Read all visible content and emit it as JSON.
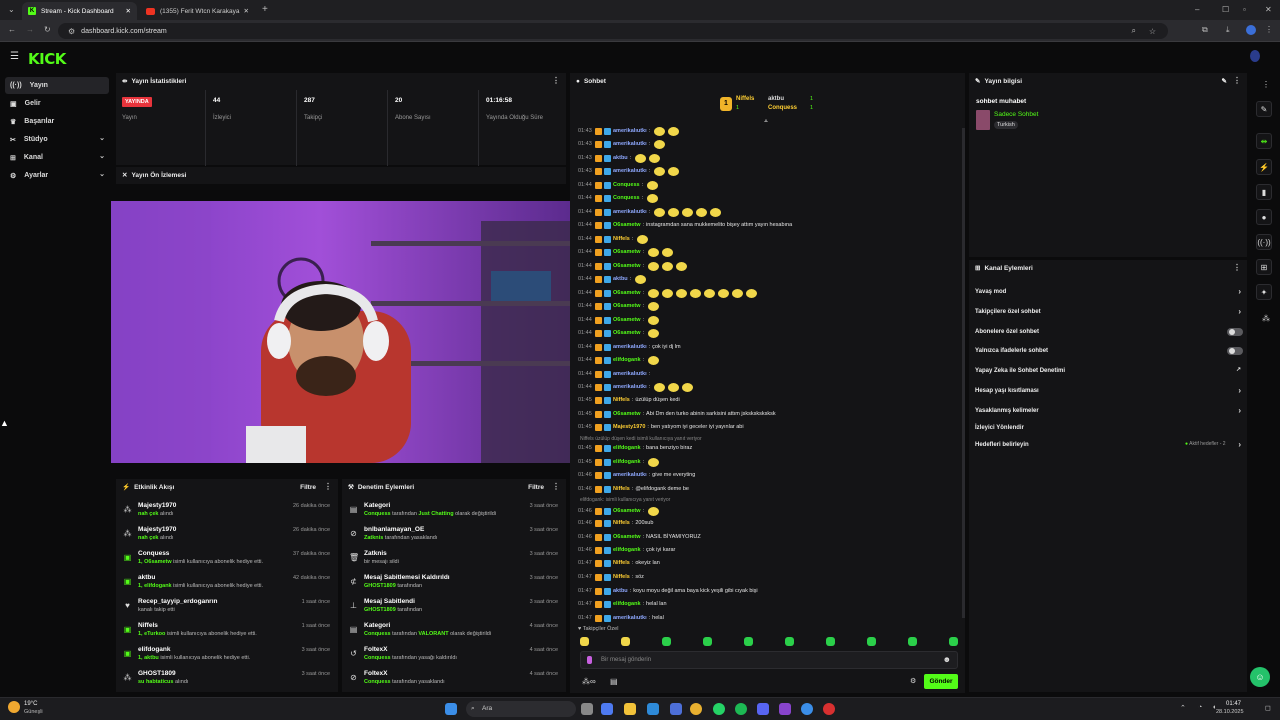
{
  "browser": {
    "tabs": [
      {
        "title": "Stream - Kick Dashboard",
        "active": true
      },
      {
        "title": "(1355) Ferit Wtcn Karakaya Saç",
        "active": false
      }
    ],
    "url": "dashboard.kick.com/stream"
  },
  "app": {
    "logo": "KICK",
    "accent": "#53fc18"
  },
  "sidebar": {
    "items": [
      {
        "label": "Yayın",
        "icon": "broadcast-icon",
        "active": true
      },
      {
        "label": "Gelir",
        "icon": "wallet-icon"
      },
      {
        "label": "Başarılar",
        "icon": "trophy-icon"
      },
      {
        "label": "Stüdyo",
        "icon": "studio-icon",
        "expandable": true
      },
      {
        "label": "Kanal",
        "icon": "channel-icon",
        "expandable": true
      },
      {
        "label": "Ayarlar",
        "icon": "gear-icon",
        "expandable": true
      }
    ]
  },
  "stats": {
    "title": "Yayın İstatistikleri",
    "live_badge": "YAYINDA",
    "live_label": "Yayın",
    "items": [
      {
        "value": "44",
        "label": "İzleyici"
      },
      {
        "value": "287",
        "label": "Takipçi"
      },
      {
        "value": "20",
        "label": "Abone Sayısı"
      },
      {
        "value": "01:16:58",
        "label": "Yayında Olduğu Süre"
      }
    ]
  },
  "preview": {
    "title": "Yayın Ön İzlemesi"
  },
  "activity": {
    "title": "Etkinlik Akışı",
    "filter": "Filtre",
    "items": [
      {
        "name": "Majesty1970",
        "highlight": "nah çek",
        "text": " alındı",
        "time": "26 dakika önce",
        "icon": "gift-icon"
      },
      {
        "name": "Majesty1970",
        "highlight": "nah çek",
        "text": " alındı",
        "time": "26 dakika önce",
        "icon": "gift-icon"
      },
      {
        "name": "Conquess",
        "highlight": "1, O6sametw",
        "text": " isimli kullanıcıya abonelik hediye etti.",
        "time": "37 dakika önce",
        "icon": "sub-icon"
      },
      {
        "name": "aktbu",
        "highlight": "1, elifdogank",
        "text": " isimli kullanıcıya abonelik hediye etti.",
        "time": "42 dakika önce",
        "icon": "sub-icon"
      },
      {
        "name": "Recep_tayyip_erdoganrın",
        "highlight": "",
        "text": "kanalı takip etti",
        "time": "1 saat önce",
        "icon": "heart-icon"
      },
      {
        "name": "Niffels",
        "highlight": "1, eTurkoo",
        "text": " isimli kullanıcıya abonelik hediye etti.",
        "time": "1 saat önce",
        "icon": "sub-icon"
      },
      {
        "name": "elifdogank",
        "highlight": "1, aktbu",
        "text": " isimli kullanıcıya abonelik hediye etti.",
        "time": "3 saat önce",
        "icon": "sub-icon"
      },
      {
        "name": "GHOST1809",
        "highlight": "su habtaticus",
        "text": " alındı",
        "time": "3 saat önce",
        "icon": "gift-icon"
      }
    ]
  },
  "moderation": {
    "title": "Denetim Eylemleri",
    "filter": "Filtre",
    "items": [
      {
        "name": "Kategori",
        "highlight": "Conquess",
        "text": " tarafından ",
        "extra": "Just Chatting",
        "tail": " olarak değiştirildi",
        "time": "3 saat önce",
        "icon": "category-icon"
      },
      {
        "name": "bnlbanlamayan_OE",
        "highlight": "Zatknis",
        "text": " tarafından yasaklandı",
        "extra": "",
        "tail": "",
        "time": "3 saat önce",
        "icon": "ban-icon"
      },
      {
        "name": "Zatknis",
        "highlight": "",
        "text": "bir mesajı sildi",
        "extra": "",
        "tail": "",
        "time": "3 saat önce",
        "icon": "trash-icon"
      },
      {
        "name": "Mesaj Sabitlemesi Kaldırıldı",
        "highlight": "GHOST1809",
        "text": " tarafından",
        "extra": "",
        "tail": "",
        "time": "3 saat önce",
        "icon": "unpin-icon"
      },
      {
        "name": "Mesaj Sabitlendi",
        "highlight": "GHOST1809",
        "text": " tarafından",
        "extra": "",
        "tail": "",
        "time": "3 saat önce",
        "icon": "pin-icon"
      },
      {
        "name": "Kategori",
        "highlight": "Conquess",
        "text": " tarafından ",
        "extra": "VALORANT",
        "tail": " olarak değiştirildi",
        "time": "4 saat önce",
        "icon": "category-icon"
      },
      {
        "name": "FoltexX",
        "highlight": "Conquess",
        "text": " tarafından yasağı kaldırıldı",
        "extra": "",
        "tail": "",
        "time": "4 saat önce",
        "icon": "unban-icon"
      },
      {
        "name": "FoltexX",
        "highlight": "Conquess",
        "text": " tarafından yasaklandı",
        "extra": "",
        "tail": "",
        "time": "4 saat önce",
        "icon": "ban-icon"
      }
    ]
  },
  "chat": {
    "title": "Sohbet",
    "top": [
      {
        "rank": "1",
        "name": "Niffels",
        "count": "1"
      },
      {
        "rank": "",
        "name": "aktbu",
        "count": "1"
      },
      {
        "rank": "",
        "name": "Conquess",
        "count": "1"
      }
    ],
    "messages": [
      {
        "time": "01:43",
        "user": "amerikalıutkı",
        "color": "#8fa9ff",
        "text": "",
        "emotes": 2
      },
      {
        "time": "01:43",
        "user": "amerikalıutkı",
        "color": "#8fa9ff",
        "text": "",
        "emotes": 1
      },
      {
        "time": "01:43",
        "user": "aktbu",
        "color": "#8fa9ff",
        "text": "",
        "emotes": 2
      },
      {
        "time": "01:43",
        "user": "amerikalıutkı",
        "color": "#8fa9ff",
        "text": "",
        "emotes": 2
      },
      {
        "time": "01:44",
        "user": "Conquess",
        "color": "#53fc18",
        "text": "",
        "emotes": 1
      },
      {
        "time": "01:44",
        "user": "Conquess",
        "color": "#53fc18",
        "text": "",
        "emotes": 1
      },
      {
        "time": "01:44",
        "user": "amerikalıutkı",
        "color": "#8fa9ff",
        "text": "",
        "emotes": 5
      },
      {
        "time": "01:44",
        "user": "O6sametw",
        "color": "#53fc18",
        "text": "instagramdan sana mukkemelito bişey attım yayın hesabına",
        "emotes": 0
      },
      {
        "time": "01:44",
        "user": "Niffels",
        "color": "#ffcf33",
        "text": "",
        "emotes": 1
      },
      {
        "time": "01:44",
        "user": "O6sametw",
        "color": "#53fc18",
        "text": "",
        "emotes": 2
      },
      {
        "time": "01:44",
        "user": "O6sametw",
        "color": "#53fc18",
        "text": "",
        "emotes": 3
      },
      {
        "time": "01:44",
        "user": "aktbu",
        "color": "#8fa9ff",
        "text": "",
        "emotes": 1
      },
      {
        "time": "01:44",
        "user": "O6sametw",
        "color": "#53fc18",
        "text": "",
        "emotes": 8
      },
      {
        "time": "01:44",
        "user": "O6sametw",
        "color": "#53fc18",
        "text": "",
        "emotes": 1
      },
      {
        "time": "01:44",
        "user": "O6sametw",
        "color": "#53fc18",
        "text": "",
        "emotes": 1
      },
      {
        "time": "01:44",
        "user": "O6sametw",
        "color": "#53fc18",
        "text": "",
        "emotes": 1
      },
      {
        "time": "01:44",
        "user": "amerikalıutkı",
        "color": "#8fa9ff",
        "text": "çok iyi dj lm",
        "emotes": 0
      },
      {
        "time": "01:44",
        "user": "elifdogank",
        "color": "#53fc18",
        "text": "",
        "emotes": 1
      },
      {
        "time": "01:44",
        "user": "amerikalıutkı",
        "color": "#8fa9ff",
        "text": "",
        "emotes": 0
      },
      {
        "time": "01:44",
        "user": "amerikalıutkı",
        "color": "#8fa9ff",
        "text": "",
        "emotes": 3
      },
      {
        "time": "01:45",
        "user": "Niffels",
        "color": "#ffcf33",
        "text": "üzülüp düşen kedi",
        "emotes": 0
      },
      {
        "time": "01:45",
        "user": "O6sametw",
        "color": "#53fc18",
        "text": "Abi Dm den turko abinin sarkisini attım jsksksksksksk",
        "emotes": 0
      },
      {
        "time": "01:45",
        "user": "Majesty1970",
        "color": "#ffcf33",
        "text": "ben yatıyom iyi geceler iyi yayınlar abi",
        "emotes": 0
      },
      {
        "time": "01:45",
        "user": "elifdogank",
        "color": "#53fc18",
        "text": "bana benziyo biraz",
        "emotes": 0
      },
      {
        "time": "01:45",
        "user": "elifdogank",
        "color": "#53fc18",
        "text": "",
        "emotes": 1
      },
      {
        "time": "01:46",
        "user": "amerikalıutkı",
        "color": "#8fa9ff",
        "text": "give me everyting",
        "emotes": 0
      },
      {
        "time": "01:46",
        "user": "Niffels",
        "color": "#ffcf33",
        "text": "@elifdogank deme be",
        "emotes": 0
      },
      {
        "time": "01:46",
        "user": "O6sametw",
        "color": "#53fc18",
        "text": "",
        "emotes": 1
      },
      {
        "time": "01:46",
        "user": "Niffels",
        "color": "#ffcf33",
        "text": "200sub",
        "emotes": 0
      },
      {
        "time": "01:46",
        "user": "O6sametw",
        "color": "#53fc18",
        "text": "NASIL BİYAMIYORUZ",
        "emotes": 0
      },
      {
        "time": "01:46",
        "user": "elifdogank",
        "color": "#53fc18",
        "text": "çok iyi karar",
        "emotes": 0
      },
      {
        "time": "01:47",
        "user": "Niffels",
        "color": "#ffcf33",
        "text": "okeyiz lan",
        "emotes": 0
      },
      {
        "time": "01:47",
        "user": "Niffels",
        "color": "#ffcf33",
        "text": "söz",
        "emotes": 0
      },
      {
        "time": "01:47",
        "user": "aktbu",
        "color": "#8fa9ff",
        "text": "koyu moyu değil ama baya kick yeşili gibi cıyak bişi",
        "emotes": 0
      },
      {
        "time": "01:47",
        "user": "elifdogank",
        "color": "#53fc18",
        "text": "helal lan",
        "emotes": 0
      },
      {
        "time": "01:47",
        "user": "amerikalıutkı",
        "color": "#8fa9ff",
        "text": "helal",
        "emotes": 0
      }
    ],
    "reply_1": "Niffels üzülüp düşen kedi isimli kullanıcıya yanıt veriyor",
    "reply_2": "elifdogank: isimli kullanıcıya yanıt veriyor",
    "followers_only": "Takipçiler Özel",
    "input_placeholder": "Bir mesaj gönderin",
    "send_label": "Gönder"
  },
  "stream_info": {
    "title": "Yayın bilgisi",
    "stream_title": "sohbet muhabet",
    "category": "Sadece Sohbet",
    "tag": "Turkish"
  },
  "channel_actions": {
    "title": "Kanal Eylemleri",
    "items": [
      {
        "label": "Yavaş mod",
        "control": "arrow"
      },
      {
        "label": "Takipçilere özel sohbet",
        "control": "arrow"
      },
      {
        "label": "Abonelere özel sohbet",
        "control": "toggle"
      },
      {
        "label": "Yalnızca ifadelerle sohbet",
        "control": "toggle"
      },
      {
        "label": "Yapay Zeka ile Sohbet Denetimi",
        "control": "external"
      },
      {
        "label": "Hesap yaşı kısıtlaması",
        "control": "arrow"
      },
      {
        "label": "Yasaklanmış kelimeler",
        "control": "arrow"
      },
      {
        "label": "İzleyici Yönlendir",
        "control": "none"
      },
      {
        "label": "Hedefleri belirleyin",
        "control": "arrow"
      }
    ],
    "goals_status": "Aktif hedefler - 2"
  },
  "taskbar": {
    "weather_temp": "19°C",
    "weather_desc": "Güneşli",
    "search_label": "Ara",
    "time": "01:47",
    "date": "28.10.2025"
  }
}
